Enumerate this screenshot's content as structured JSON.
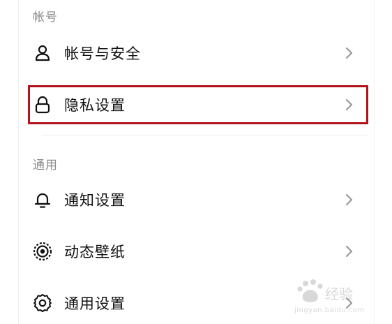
{
  "sections": [
    {
      "header": "帐号",
      "items": [
        {
          "label": "帐号与安全",
          "icon": "user-icon"
        },
        {
          "label": "隐私设置",
          "icon": "lock-icon",
          "highlighted": true
        }
      ]
    },
    {
      "header": "通用",
      "items": [
        {
          "label": "通知设置",
          "icon": "bell-icon"
        },
        {
          "label": "动态壁纸",
          "icon": "target-icon"
        },
        {
          "label": "通用设置",
          "icon": "gear-icon"
        }
      ]
    }
  ],
  "watermark": {
    "text": "jingyan.baidu.com"
  },
  "colors": {
    "highlight_border": "#b3121b",
    "section_header": "#8a8a8a",
    "chevron": "#9a9a9a",
    "text": "#111111"
  }
}
